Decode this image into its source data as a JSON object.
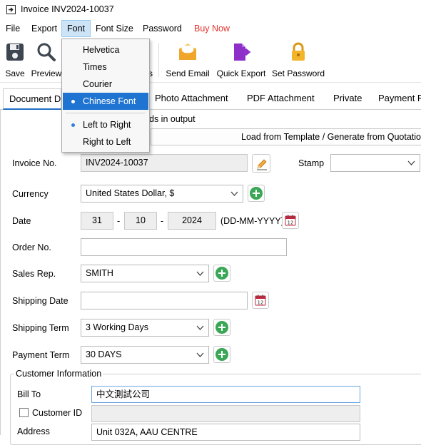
{
  "window": {
    "title": "Invoice INV2024-10037",
    "icon": "invoice-window-icon"
  },
  "menubar": {
    "items": [
      "File",
      "Export",
      "Font",
      "Font Size",
      "Password",
      "Buy Now"
    ],
    "active": "Font",
    "buy_now_color": "#e3342f"
  },
  "font_menu": {
    "items": [
      "Helvetica",
      "Times",
      "Courier",
      "Chinese Font",
      "Left to Right",
      "Right to Left"
    ],
    "selected": "Chinese Font",
    "highlight_color": "#1f74d1"
  },
  "toolbar": {
    "save": "Save",
    "preview": "Preview",
    "hidden_partial": "s",
    "send_email": "Send Email",
    "quick_export": "Quick Export",
    "set_password": "Set Password"
  },
  "tabs": [
    "Document D",
    "Photo Attachment",
    "PDF Attachment",
    "Private",
    "Payment F"
  ],
  "content": {
    "partial_text": "ds in output",
    "template_button": "Load from Template / Generate from Quotation",
    "invoice_no_label": "Invoice No.",
    "invoice_no": "INV2024-10037",
    "stamp_label": "Stamp",
    "stamp_value": "",
    "currency_label": "Currency",
    "currency": "United States Dollar, $",
    "date_label": "Date",
    "date_day": "31",
    "date_month": "10",
    "date_year": "2024",
    "date_sep1": "-",
    "date_sep2": "-",
    "date_format": "(DD-MM-YYYY)",
    "order_no_label": "Order No.",
    "order_no": "",
    "sales_rep_label": "Sales Rep.",
    "sales_rep": "SMITH",
    "shipping_date_label": "Shipping Date",
    "shipping_date": "",
    "shipping_term_label": "Shipping Term",
    "shipping_term": "3 Working Days",
    "payment_term_label": "Payment Term",
    "payment_term": "30 DAYS",
    "customer_info_title": "Customer Information",
    "bill_to_label": "Bill To",
    "bill_to": "中文測試公司",
    "customer_id_label": "Customer ID",
    "customer_id_checked": false,
    "address_label": "Address",
    "address": "Unit 032A, AAU CENTRE"
  },
  "colors": {
    "accent": "#1f6fc5",
    "plus_green": "#3aa757",
    "calendar_red": "#c0263b"
  }
}
